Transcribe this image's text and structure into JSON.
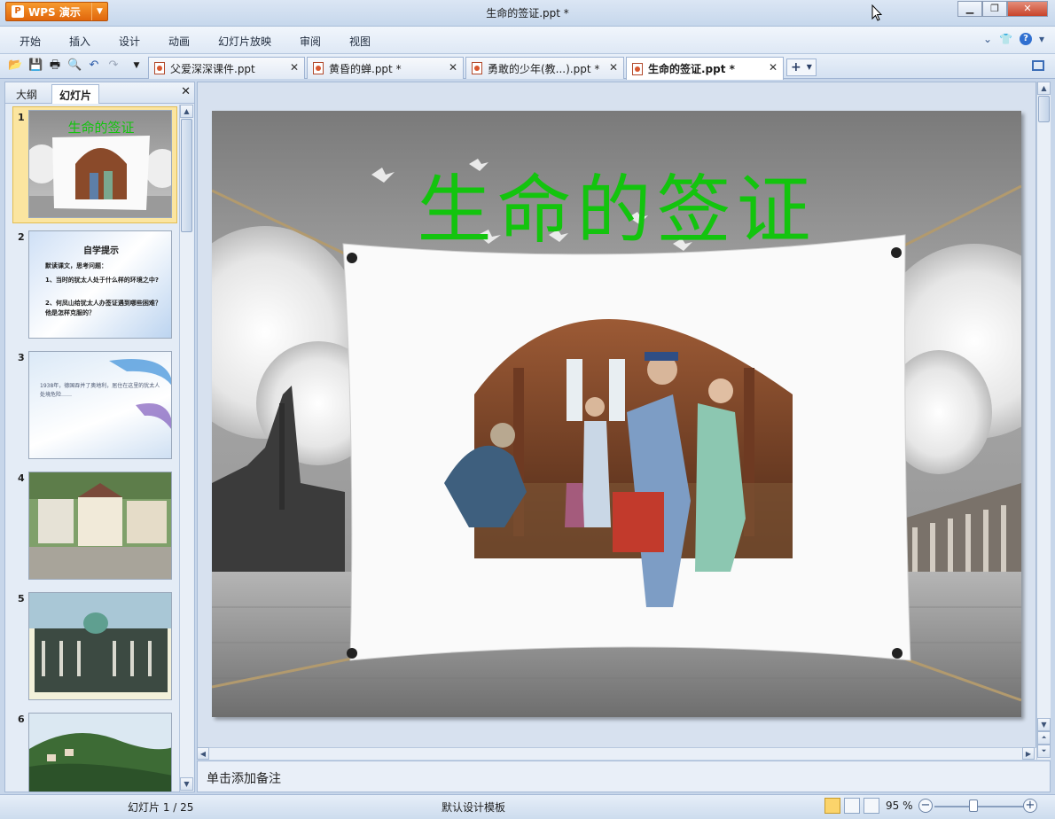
{
  "window": {
    "title": "生命的签证.ppt *",
    "app_button": "WPS 演示"
  },
  "menu": {
    "items": [
      "开始",
      "插入",
      "设计",
      "动画",
      "幻灯片放映",
      "审阅",
      "视图"
    ]
  },
  "tabs": [
    {
      "label": "父爱深深课件.ppt",
      "active": false
    },
    {
      "label": "黄昏的蝉.ppt *",
      "active": false
    },
    {
      "label": "勇敢的少年(教...).ppt *",
      "active": false
    },
    {
      "label": "生命的签证.ppt *",
      "active": true
    }
  ],
  "left_pane": {
    "tabs": [
      "大纲",
      "幻灯片"
    ],
    "active_tab": "幻灯片",
    "slides": [
      {
        "num": "1",
        "title": "生命的签证"
      },
      {
        "num": "2",
        "title": "自学提示",
        "lines": [
          "默读课文，思考问题：",
          "1、当时的犹太人处于什么样的环境之中?",
          "2、何凤山给犹太人办签证遇到哪些困难？他是怎样克服的？"
        ]
      },
      {
        "num": "3",
        "text": "1938年，德国吞并了奥地利，居住在这里的犹太人处境危险……"
      },
      {
        "num": "4"
      },
      {
        "num": "5"
      },
      {
        "num": "6"
      }
    ]
  },
  "slide": {
    "title": "生命的签证"
  },
  "notes": {
    "placeholder": "单击添加备注"
  },
  "status": {
    "slide_counter": "幻灯片 1 / 25",
    "template": "默认设计模板",
    "zoom": "95 %"
  },
  "colors": {
    "title_green": "#13c40e",
    "accent_orange": "#e0660c",
    "chrome_blue": "#c7d6ea"
  }
}
